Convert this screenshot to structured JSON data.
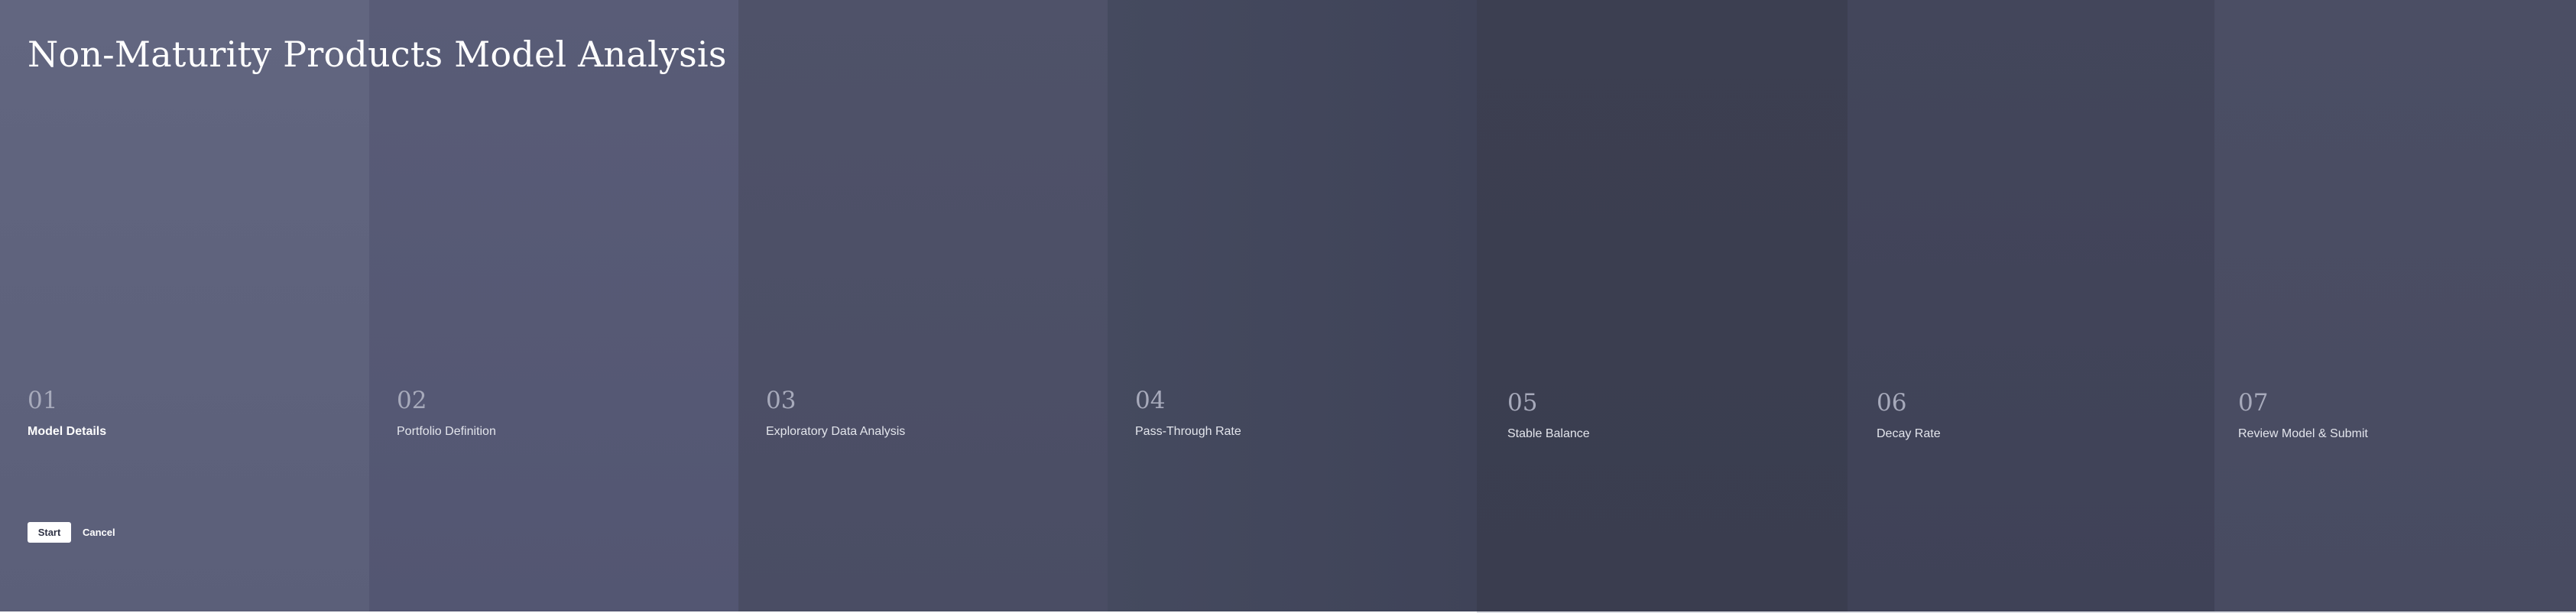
{
  "page": {
    "title": "Non-Maturity Products Model Analysis"
  },
  "steps": [
    {
      "number": "01",
      "label": "Model Details",
      "active": true
    },
    {
      "number": "02",
      "label": "Portfolio Definition",
      "active": false
    },
    {
      "number": "03",
      "label": "Exploratory Data Analysis",
      "active": false
    },
    {
      "number": "04",
      "label": "Pass-Through Rate",
      "active": false
    },
    {
      "number": "05",
      "label": "Stable Balance",
      "active": false
    },
    {
      "number": "06",
      "label": "Decay Rate",
      "active": false
    },
    {
      "number": "07",
      "label": "Review Model & Submit",
      "active": false
    }
  ],
  "actions": {
    "start_label": "Start",
    "cancel_label": "Cancel"
  },
  "colors": {
    "text_primary": "#ffffff",
    "step_number": "#a7aabb",
    "start_button_bg": "#ffffff"
  }
}
